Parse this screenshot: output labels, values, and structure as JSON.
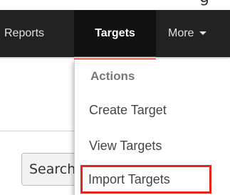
{
  "nav": {
    "reports": "Reports",
    "targets": "Targets",
    "more": "More",
    "accent_color": "#cc2a0f"
  },
  "dropdown": {
    "header": "Actions",
    "items": [
      "Create Target",
      "View Targets",
      "Import Targets"
    ],
    "highlight_color": "#e8231a"
  },
  "content": {
    "search_button_label": "Search"
  },
  "partial_text": "g"
}
